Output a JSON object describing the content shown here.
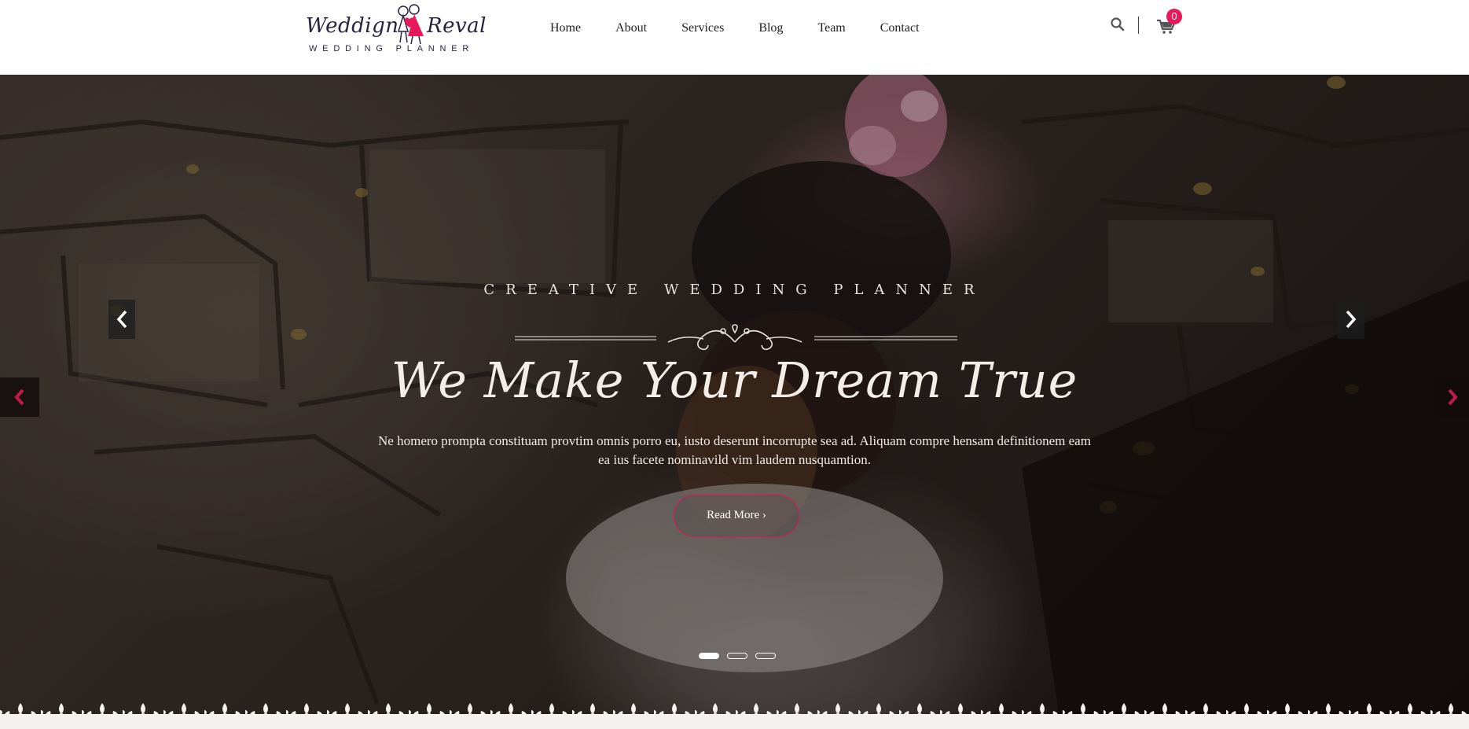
{
  "header": {
    "logo": {
      "left_word": "Weddign",
      "right_word": "Reval",
      "tagline": "WEDDING PLANNER"
    },
    "nav": [
      {
        "label": "Home"
      },
      {
        "label": "About"
      },
      {
        "label": "Services"
      },
      {
        "label": "Blog"
      },
      {
        "label": "Team"
      },
      {
        "label": "Contact"
      }
    ],
    "cart_count": "0",
    "icons": {
      "search": "search-icon",
      "cart": "cart-icon"
    }
  },
  "hero": {
    "kicker": "CREATIVE WEDDING PLANNER",
    "headline": "We Make Your Dream True",
    "description": "Ne homero prompta constituam provtim omnis porro eu, iusto deserunt incorrupte sea ad. Aliquam compre hensam definitionem eam ea ius facete nominavild vim laudem nusquamtion.",
    "button_label": "Read More ›",
    "slides": 3,
    "active_slide": 1
  },
  "colors": {
    "accent": "#e8195a",
    "button_border": "#d61a55",
    "text_dark": "#222222",
    "logo_ink": "#2a2340"
  }
}
